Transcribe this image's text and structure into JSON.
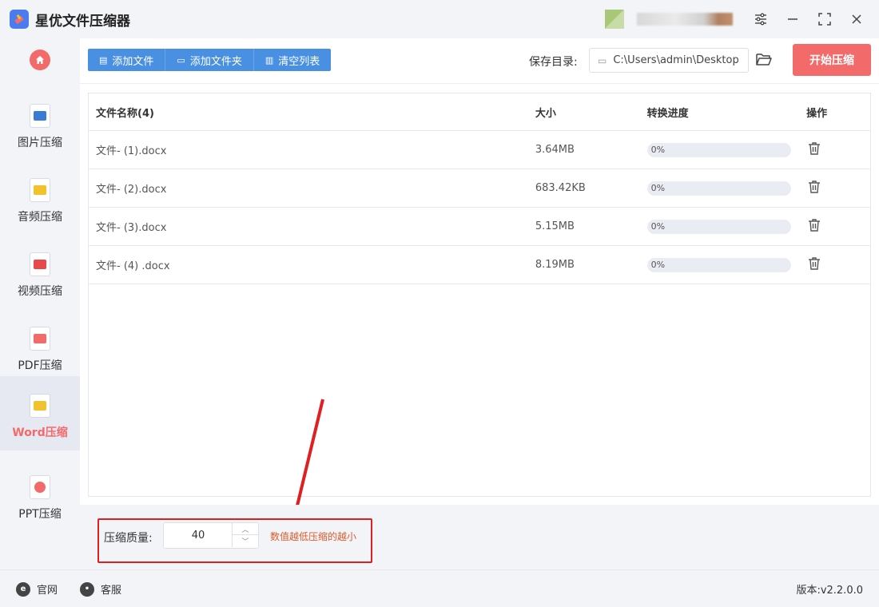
{
  "app": {
    "title": "星优文件压缩器"
  },
  "sidebar": {
    "items": [
      {
        "label": "图片压缩",
        "icon": "image-file-icon",
        "color": "#3a7bd5"
      },
      {
        "label": "音频压缩",
        "icon": "audio-file-icon",
        "color": "#f2c12e"
      },
      {
        "label": "视频压缩",
        "icon": "video-file-icon",
        "color": "#e84a4a"
      },
      {
        "label": "PDF压缩",
        "icon": "pdf-file-icon",
        "color": "#f36a6a"
      },
      {
        "label": "Word压缩",
        "icon": "word-file-icon",
        "color": "#f2c12e",
        "active": true
      },
      {
        "label": "PPT压缩",
        "icon": "ppt-file-icon",
        "color": "#f36a6a"
      }
    ]
  },
  "toolbar": {
    "add_file": "添加文件",
    "add_folder": "添加文件夹",
    "clear_list": "清空列表",
    "save_label": "保存目录:",
    "save_path": "C:\\Users\\admin\\Desktop",
    "start": "开始压缩"
  },
  "table": {
    "headers": {
      "name": "文件名称(4)",
      "size": "大小",
      "progress": "转换进度",
      "op": "操作"
    },
    "rows": [
      {
        "name": "文件- (1).docx",
        "size": "3.64MB",
        "progress": "0%",
        "fraction": 0
      },
      {
        "name": "文件- (2).docx",
        "size": "683.42KB",
        "progress": "0%",
        "fraction": 0
      },
      {
        "name": "文件- (3).docx",
        "size": "5.15MB",
        "progress": "0%",
        "fraction": 0
      },
      {
        "name": "文件- (4) .docx",
        "size": "8.19MB",
        "progress": "0%",
        "fraction": 0
      }
    ]
  },
  "quality": {
    "label": "压缩质量:",
    "value": "40",
    "hint": "数值越低压缩的越小"
  },
  "footer": {
    "website": "官网",
    "support": "客服",
    "version": "版本:v2.2.0.0"
  },
  "colors": {
    "accent": "#4a90e2",
    "primary_red": "#f36a6a",
    "highlight_red": "#e02020",
    "hint_orange": "#e05a2a"
  }
}
